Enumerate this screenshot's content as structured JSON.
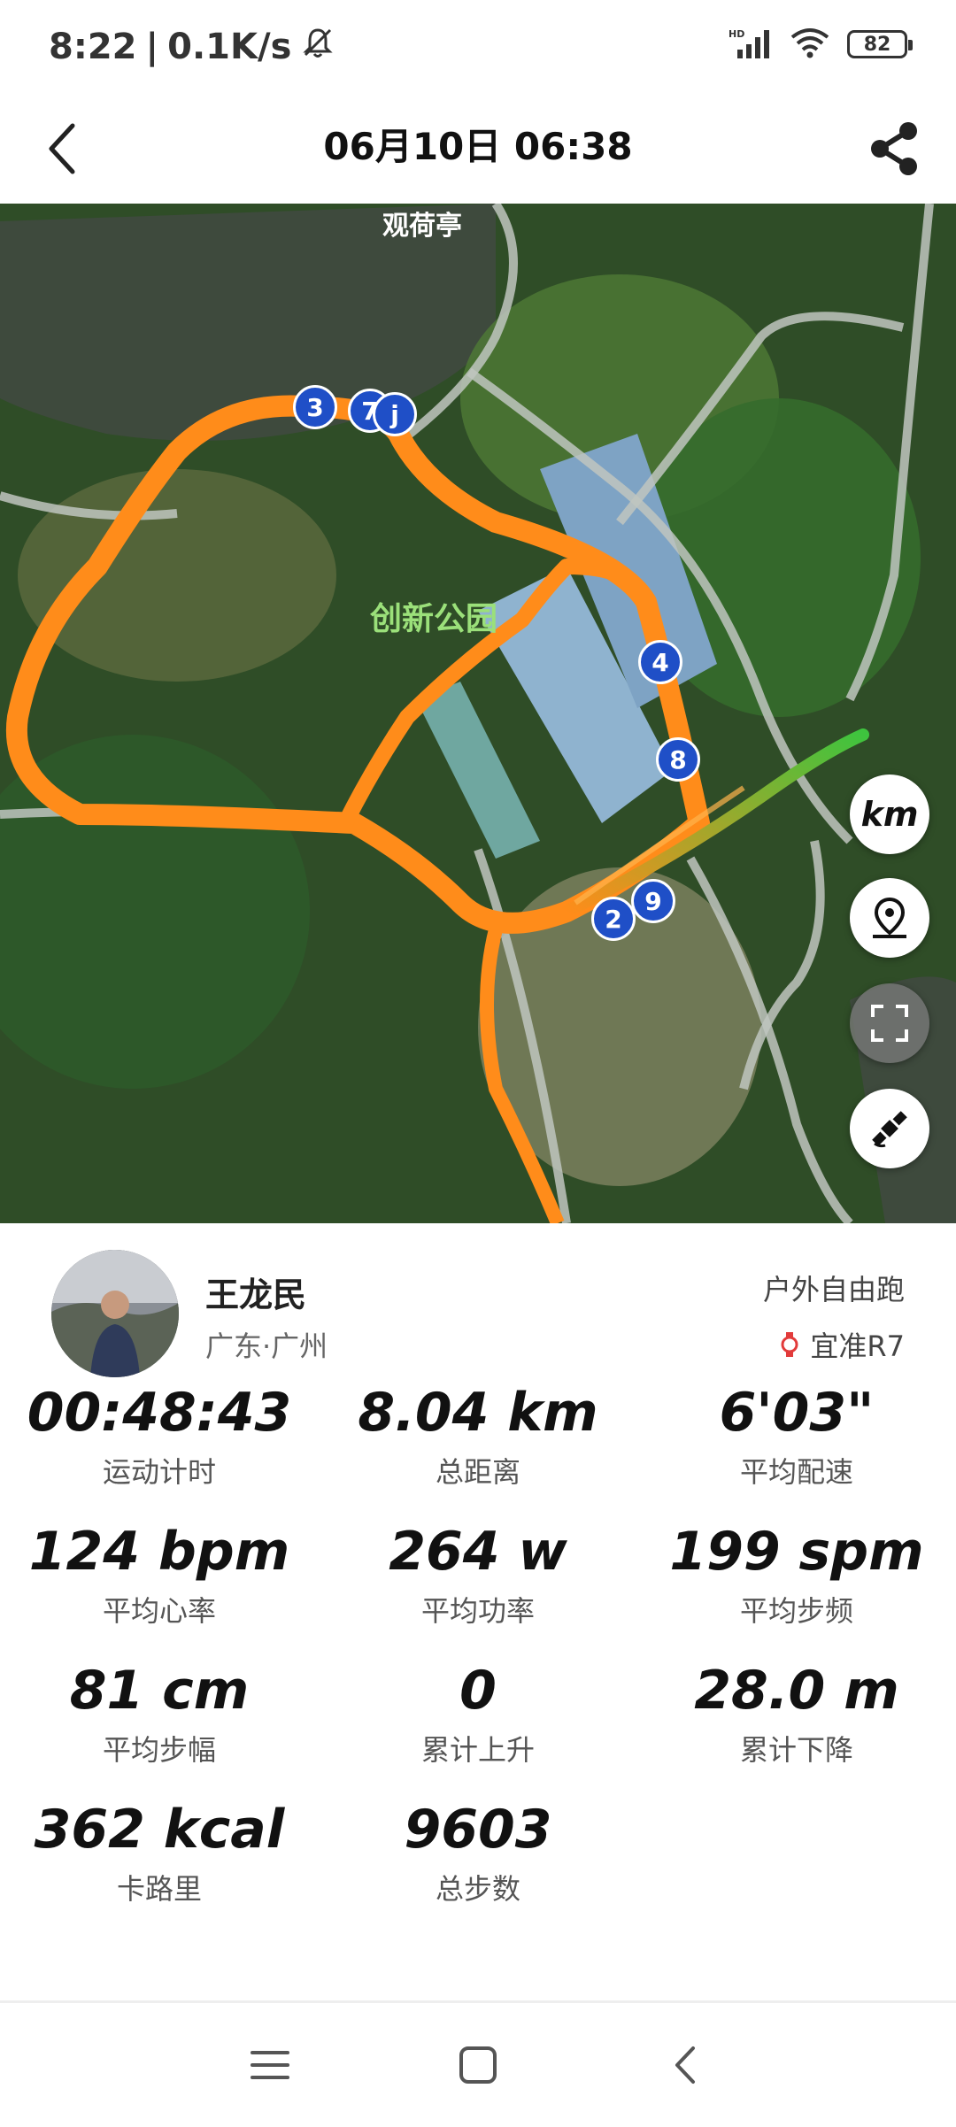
{
  "status_bar": {
    "time": "8:22",
    "speed": "0.1K/s",
    "battery": "82"
  },
  "header": {
    "title": "06月10日 06:38"
  },
  "map": {
    "place_labels": [
      "观荷亭",
      "创新公园"
    ],
    "markers": [
      "3",
      "7",
      "j",
      "4",
      "8",
      "2",
      "9"
    ],
    "units_button": "km"
  },
  "profile": {
    "name": "王龙民",
    "location": "广东·广州",
    "activity_type": "户外自由跑",
    "device": "宜准R7"
  },
  "stats": [
    {
      "value": "00:48:43",
      "label": "运动计时"
    },
    {
      "value": "8.04 km",
      "label": "总距离"
    },
    {
      "value": "6'03\"",
      "label": "平均配速"
    },
    {
      "value": "124 bpm",
      "label": "平均心率"
    },
    {
      "value": "264 w",
      "label": "平均功率"
    },
    {
      "value": "199 spm",
      "label": "平均步频"
    },
    {
      "value": "81 cm",
      "label": "平均步幅"
    },
    {
      "value": "0",
      "label": "累计上升"
    },
    {
      "value": "28.0 m",
      "label": "累计下降"
    },
    {
      "value": "362 kcal",
      "label": "卡路里"
    },
    {
      "value": "9603",
      "label": "总步数"
    }
  ],
  "colors": {
    "route": "#ff8c1a",
    "route_end": "#3ec43e",
    "marker": "#1f4fc7"
  }
}
